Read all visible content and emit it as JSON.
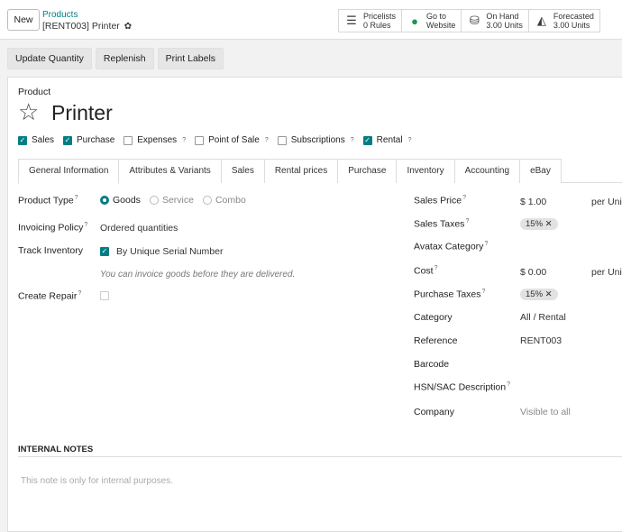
{
  "header": {
    "new_label": "New",
    "breadcrumb_parent": "Products",
    "breadcrumb_current": "[RENT003] Printer"
  },
  "smart_buttons": [
    {
      "icon": "list-icon",
      "label": "Pricelists",
      "value": "0 Rules"
    },
    {
      "icon": "globe-icon",
      "label": "Go to",
      "value": "Website"
    },
    {
      "icon": "cubes-icon",
      "label": "On Hand",
      "value": "3.00 Units"
    },
    {
      "icon": "area-chart-icon",
      "label": "Forecasted",
      "value": "3.00 Units"
    }
  ],
  "actions": {
    "update_quantity": "Update Quantity",
    "replenish": "Replenish",
    "print_labels": "Print Labels"
  },
  "product": {
    "label": "Product",
    "name": "Printer"
  },
  "flags": [
    {
      "label": "Sales",
      "checked": true,
      "help": ""
    },
    {
      "label": "Purchase",
      "checked": true,
      "help": ""
    },
    {
      "label": "Expenses",
      "checked": false,
      "help": "?"
    },
    {
      "label": "Point of Sale",
      "checked": false,
      "help": "?"
    },
    {
      "label": "Subscriptions",
      "checked": false,
      "help": "?"
    },
    {
      "label": "Rental",
      "checked": true,
      "help": "?"
    }
  ],
  "tabs": [
    "General Information",
    "Attributes & Variants",
    "Sales",
    "Rental prices",
    "Purchase",
    "Inventory",
    "Accounting",
    "eBay"
  ],
  "left": {
    "product_type_label": "Product Type",
    "product_type_options": [
      "Goods",
      "Service",
      "Combo"
    ],
    "invoicing_policy_label": "Invoicing Policy",
    "invoicing_policy_value": "Ordered quantities",
    "track_inventory_label": "Track Inventory",
    "track_inventory_value": "By Unique Serial Number",
    "invoice_hint": "You can invoice goods before they are delivered.",
    "create_repair_label": "Create Repair"
  },
  "right": {
    "sales_price_label": "Sales Price",
    "sales_price_value": "$ 1.00",
    "sales_price_unit": "per Unit",
    "sales_taxes_label": "Sales Taxes",
    "sales_taxes_tag": "15%",
    "avatax_label": "Avatax Category",
    "cost_label": "Cost",
    "cost_value": "$ 0.00",
    "cost_unit": "per Unit",
    "purchase_taxes_label": "Purchase Taxes",
    "purchase_taxes_tag": "15%",
    "category_label": "Category",
    "category_value": "All / Rental",
    "reference_label": "Reference",
    "reference_value": "RENT003",
    "barcode_label": "Barcode",
    "hsn_label": "HSN/SAC Description",
    "company_label": "Company",
    "company_placeholder": "Visible to all"
  },
  "notes": {
    "heading": "INTERNAL NOTES",
    "placeholder": "This note is only for internal purposes."
  },
  "colors": {
    "accent": "#017e84"
  }
}
